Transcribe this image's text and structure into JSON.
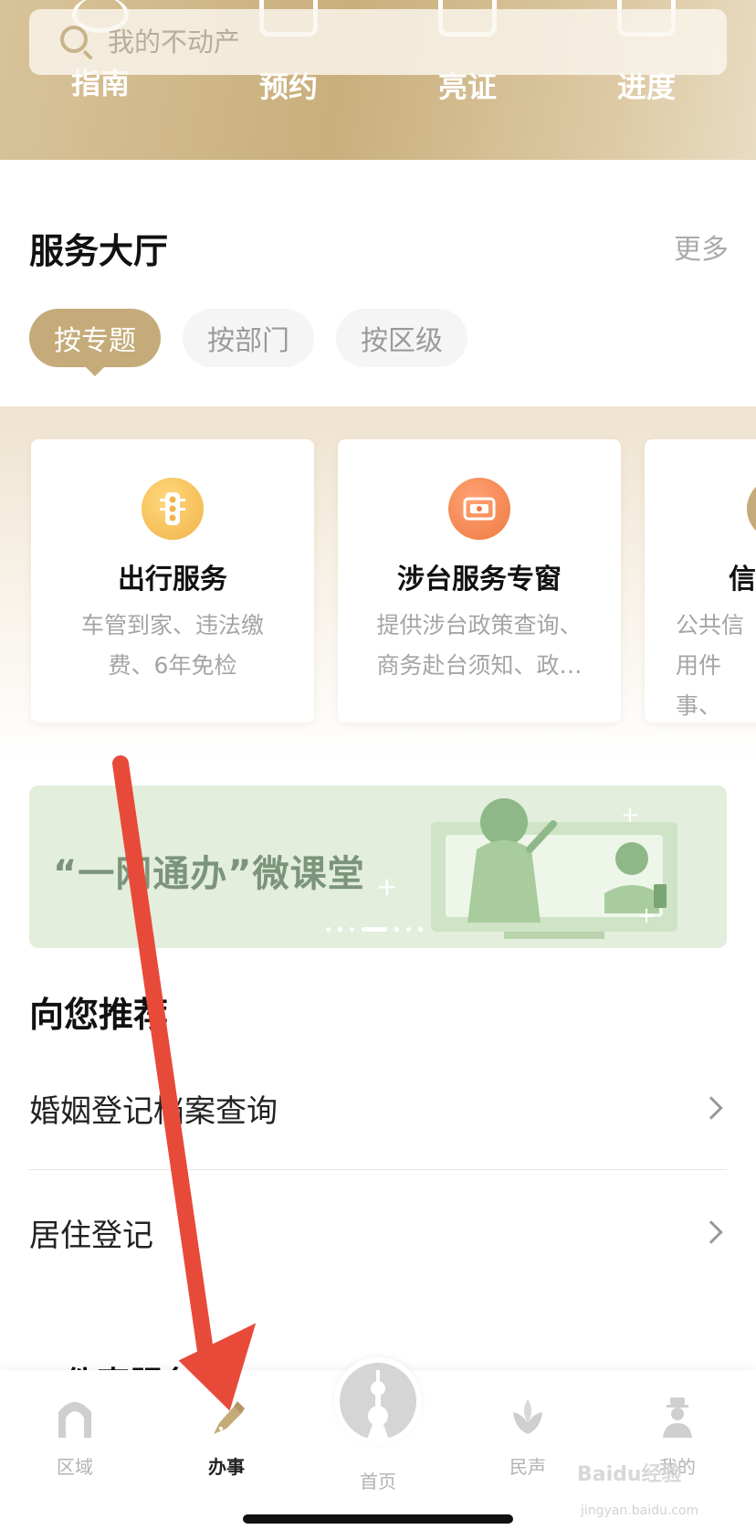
{
  "search": {
    "placeholder": "我的不动产"
  },
  "quick_links": [
    {
      "label": "指南",
      "icon": "compass-icon"
    },
    {
      "label": "预约",
      "icon": "calendar-icon"
    },
    {
      "label": "亮证",
      "icon": "card-icon"
    },
    {
      "label": "进度",
      "icon": "bar-chart-icon"
    }
  ],
  "service_hall": {
    "title": "服务大厅",
    "more": "更多",
    "tabs": [
      "按专题",
      "按部门",
      "按区级"
    ],
    "active_tab": "按专题",
    "cards": [
      {
        "title": "出行服务",
        "desc": "车管到家、违法缴费、6年免检",
        "icon": "traffic-light-icon",
        "color": "#f0b44a"
      },
      {
        "title": "涉台服务专窗",
        "desc": "提供涉台政策查询、商务赴台须知、政…",
        "icon": "window-service-icon",
        "color": "#ee7a42"
      },
      {
        "title": "信",
        "desc": "公共信用件事、",
        "icon": "credit-icon",
        "color": "#c4ab79"
      }
    ]
  },
  "banner": {
    "title": "“一网通办”微课堂",
    "color": "#7c957a"
  },
  "recommend": {
    "title": "向您推荐",
    "items": [
      "婚姻登记档案查询",
      "居住登记"
    ],
    "next_section_title": "件事服务"
  },
  "bottom_nav": {
    "items": [
      {
        "label": "区域",
        "icon": "region-icon"
      },
      {
        "label": "办事",
        "icon": "pen-icon",
        "active": true
      },
      {
        "label": "首页",
        "icon": "tower-icon"
      },
      {
        "label": "民声",
        "icon": "flower-icon"
      },
      {
        "label": "我的",
        "icon": "person-icon"
      }
    ]
  },
  "watermark": {
    "brand": "Baidu经验",
    "url": "jingyan.baidu.com"
  },
  "colors": {
    "accent": "#c4ab79",
    "arrow": "#e84a3a"
  }
}
